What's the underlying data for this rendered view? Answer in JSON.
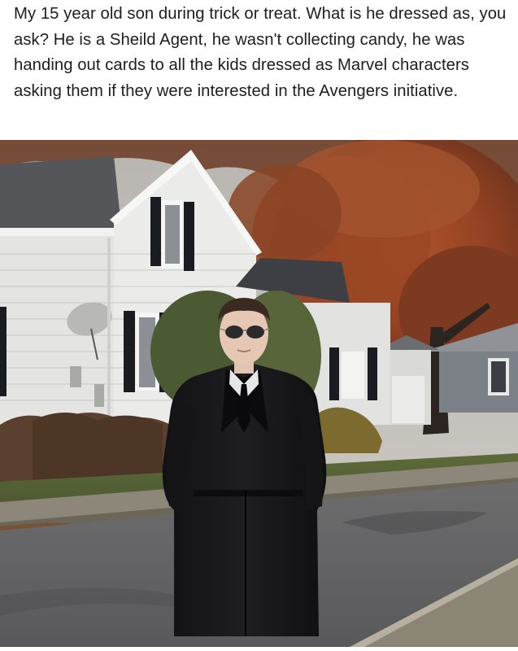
{
  "post": {
    "caption": "My 15 year old son during trick or treat. What is he dressed as, you ask? He is a Sheild Agent, he wasn't collecting candy, he was handing out cards to all the kids dressed as Marvel characters asking them if they were  interested in the Avengers initiative."
  }
}
